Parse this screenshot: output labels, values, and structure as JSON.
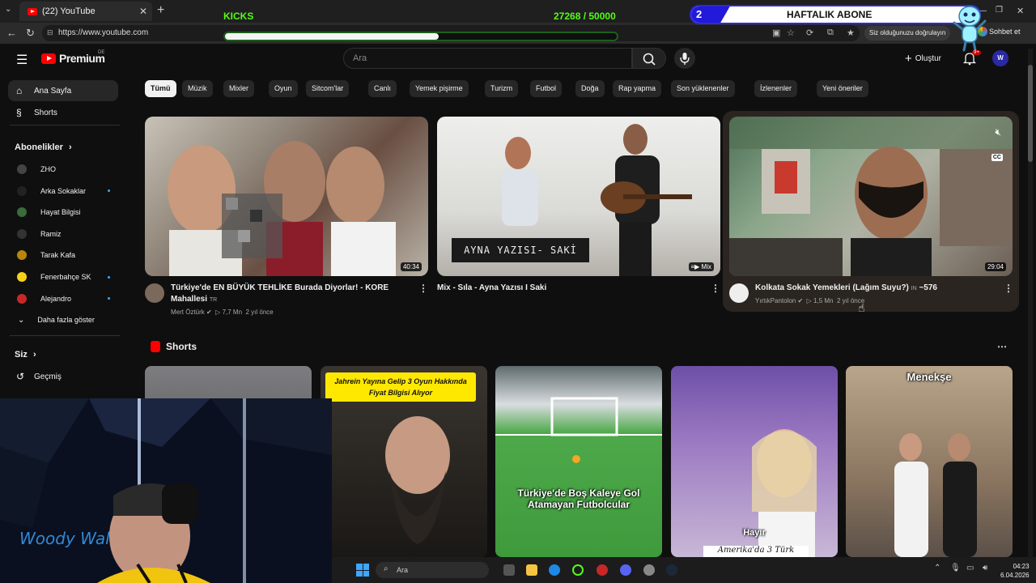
{
  "browser": {
    "tab_title": "(22) YouTube",
    "tab_close": "✕",
    "new_tab": "+",
    "url": "https://www.youtube.com",
    "verify_text": "Siz olduğunuzu doğrulayın",
    "chat_label": "Sohbet et"
  },
  "overlay": {
    "kicks_label": "KICKS",
    "kicks_count": "27268 / 50000",
    "kicks_progress": 0.5454,
    "sub_goal_number": "2",
    "sub_goal_label": "HAFTALIK ABONE"
  },
  "header": {
    "logo_text": "Premium",
    "country_code": "DE",
    "search_placeholder": "Ara",
    "create_label": "Oluştur",
    "notif_badge": "9+",
    "avatar_letter": "W"
  },
  "sidebar": {
    "home": "Ana Sayfa",
    "shorts": "Shorts",
    "subscriptions_heading": "Abonelikler",
    "subscriptions": [
      {
        "name": "ZHO",
        "color": "#444",
        "dot": false
      },
      {
        "name": "Arka Sokaklar",
        "color": "#222",
        "dot": true
      },
      {
        "name": "Hayat Bilgisi",
        "color": "#3a6b3a",
        "dot": false
      },
      {
        "name": "Ramiz",
        "color": "#333",
        "dot": false
      },
      {
        "name": "Tarak Kafa",
        "color": "#b8860b",
        "dot": false
      },
      {
        "name": "Fenerbahçe SK",
        "color": "#f7d117",
        "dot": true
      },
      {
        "name": "Alejandro",
        "color": "#c62828",
        "dot": true
      }
    ],
    "show_more": "Daha fazla göster",
    "you_heading": "Siz",
    "history": "Geçmiş"
  },
  "chips": [
    "Tümü",
    "Müzik",
    "Mixler",
    "Oyun",
    "Sitcom'lar",
    "Canlı",
    "Yemek pişirme",
    "Turizm",
    "Futbol",
    "Doğa",
    "Rap yapma",
    "Son yüklenenler",
    "İzlenenler",
    "Yeni öneriler"
  ],
  "videos": [
    {
      "title_line1": "Türkiye'de EN BÜYÜK TEHLİKE Burada Diyorlar! - KORE",
      "title_line2": "Mahallesi",
      "flag": "TR",
      "channel": "Mert Öztürk",
      "views": "7,7 Mn",
      "age": "2 yıl önce",
      "duration": "40:34"
    },
    {
      "title_line1": "Mix - Sıla - Ayna Yazısı I Saki",
      "overlay_text": "AYNA YAZISI- SAKİ",
      "badge": "Mix"
    },
    {
      "title_line1": "Kolkata Sokak Yemekleri (Lağım Suyu?)",
      "flag": "IN",
      "extra": "~576",
      "channel": "YırtıkPantolon",
      "views": "1,5 Mn",
      "age": "2 yıl önce",
      "duration": "29:04",
      "cc": "CC"
    }
  ],
  "shorts_section": {
    "heading": "Shorts",
    "items": [
      {
        "caption": ""
      },
      {
        "caption": "Jahrein Yayına Gelip 3 Oyun Hakkında Fiyat Bilgisi Alıyor"
      },
      {
        "caption": "Türkiye'de Boş Kaleye Gol Atamayan Futbolcular"
      },
      {
        "caption": "Hayır",
        "caption2": "Amerika'da 3 Türk"
      },
      {
        "caption": "Menekşe"
      }
    ]
  },
  "taskbar": {
    "search_label": "Ara",
    "time": "04:23",
    "date": "6.04.2026"
  },
  "colors": {
    "kicks_green": "#53fc18",
    "yt_red": "#ff0000",
    "sub_goal_blue": "#2319d8"
  }
}
